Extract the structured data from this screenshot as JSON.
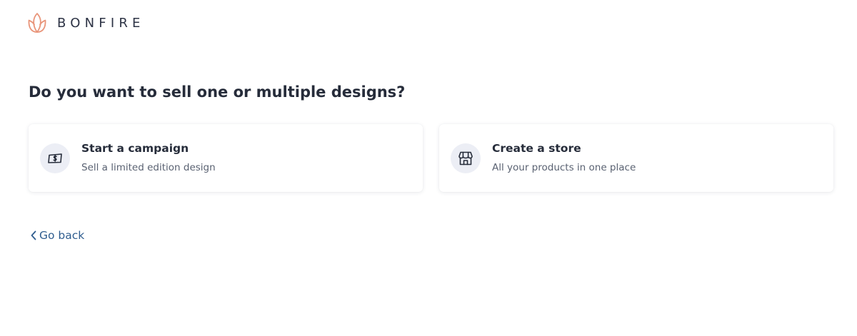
{
  "header": {
    "logo_text": "BONFIRE",
    "logo_icon": "flame-leaf-icon",
    "logo_color": "#e9957a"
  },
  "page": {
    "question": "Do you want to sell one or multiple designs?"
  },
  "options": [
    {
      "icon": "money-icon",
      "title": "Start a campaign",
      "subtitle": "Sell a limited edition design"
    },
    {
      "icon": "storefront-icon",
      "title": "Create a store",
      "subtitle": "All your products in one place"
    }
  ],
  "nav": {
    "back_label": "Go back",
    "back_icon": "chevron-left-icon",
    "link_color": "#2f5d8f"
  }
}
